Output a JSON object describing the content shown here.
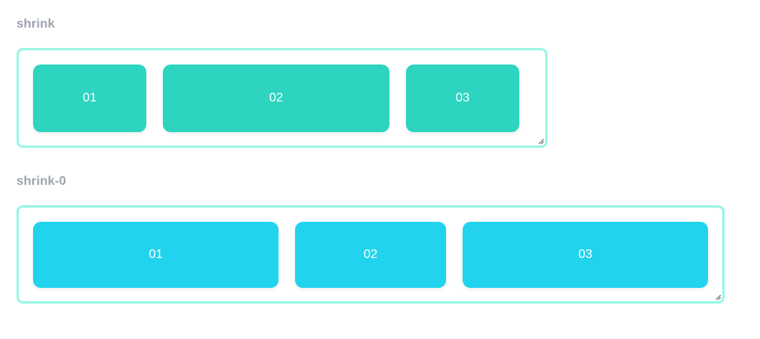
{
  "sections": [
    {
      "label": "shrink",
      "boxes": [
        {
          "label": "01"
        },
        {
          "label": "02"
        },
        {
          "label": "03"
        }
      ],
      "color": "#2dd4bf"
    },
    {
      "label": "shrink-0",
      "boxes": [
        {
          "label": "01"
        },
        {
          "label": "02"
        },
        {
          "label": "03"
        }
      ],
      "color": "#22d3ee"
    }
  ],
  "border_color": "#99f6e4",
  "label_color": "#9ca3af"
}
